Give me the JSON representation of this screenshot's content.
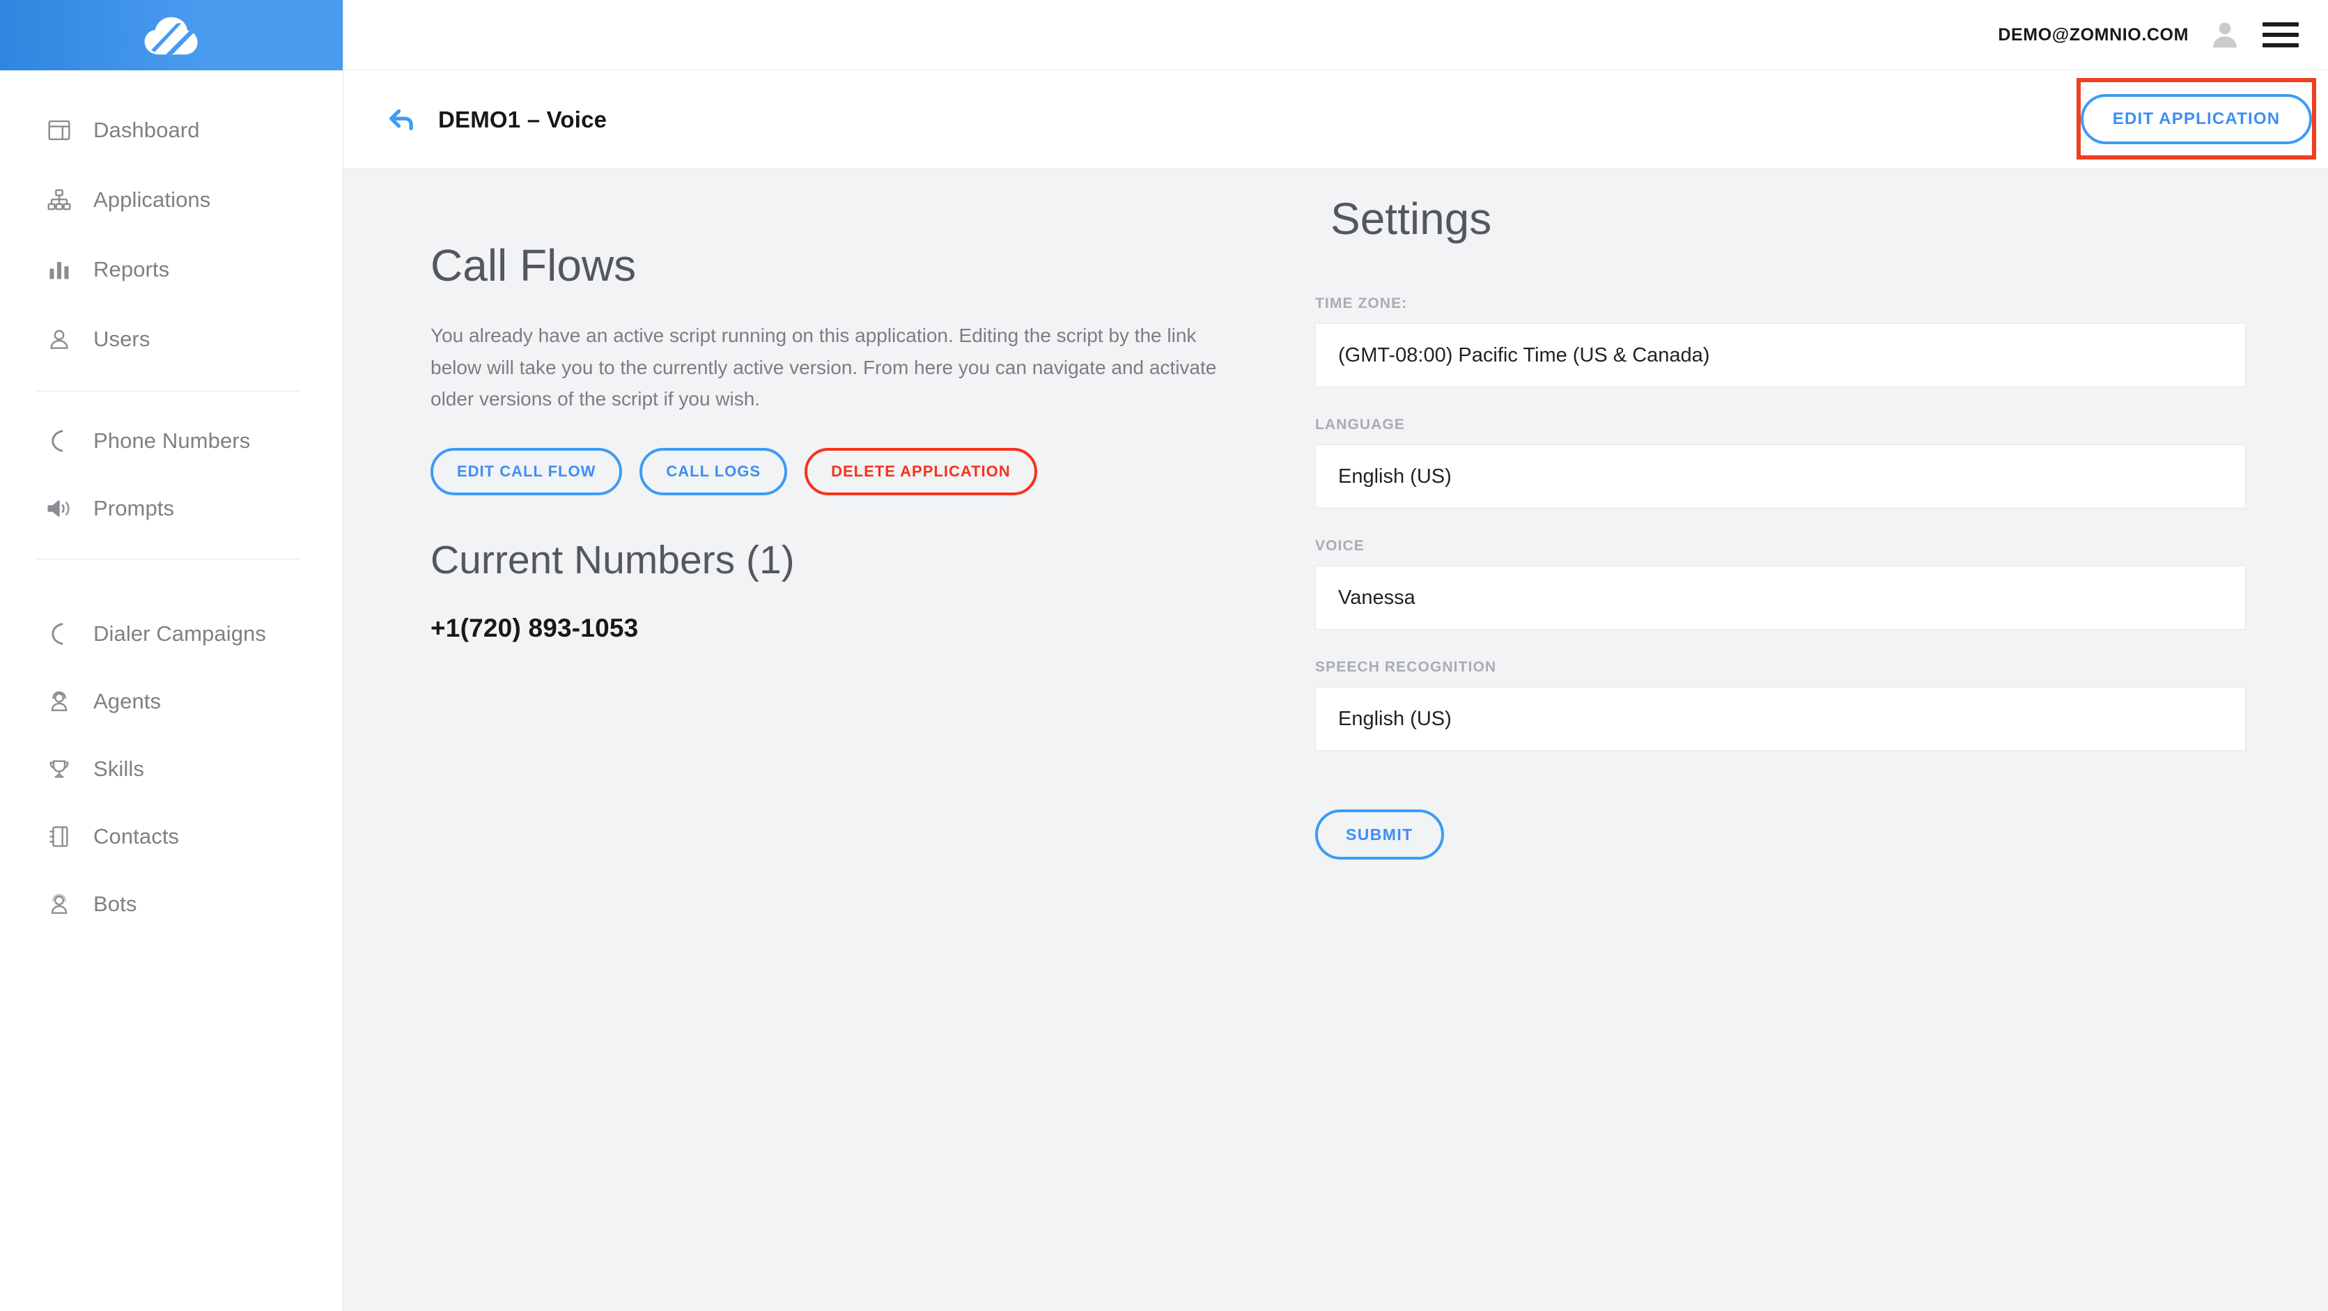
{
  "brand": {
    "logo_icon": "cloud-swoosh-logo",
    "accent_blue": "#3d9bf5",
    "accent_red": "#f5321a",
    "header_band": "#4a9bf0"
  },
  "sidebar": {
    "groups": [
      {
        "items": [
          {
            "label": "Dashboard",
            "icon": "dashboard-icon"
          },
          {
            "label": "Applications",
            "icon": "sitemap-icon"
          },
          {
            "label": "Reports",
            "icon": "bar-chart-icon"
          },
          {
            "label": "Users",
            "icon": "user-icon"
          }
        ]
      },
      {
        "items": [
          {
            "label": "Phone Numbers",
            "icon": "phone-icon"
          },
          {
            "label": "Prompts",
            "icon": "speaker-icon"
          }
        ]
      },
      {
        "items": [
          {
            "label": "Dialer Campaigns",
            "icon": "phone-icon"
          },
          {
            "label": "Agents",
            "icon": "agent-headset-icon"
          },
          {
            "label": "Skills",
            "icon": "trophy-icon"
          },
          {
            "label": "Contacts",
            "icon": "address-book-icon"
          },
          {
            "label": "Bots",
            "icon": "bot-icon"
          }
        ]
      }
    ]
  },
  "topbar": {
    "user_email": "DEMO@ZOMNIO.COM",
    "avatar_icon": "avatar-icon",
    "menu_icon": "hamburger-menu-icon"
  },
  "titlebar": {
    "back_icon": "back-arrow-icon",
    "title": "DEMO1 – Voice",
    "edit_application_label": "EDIT APPLICATION"
  },
  "call_flows": {
    "heading": "Call Flows",
    "description": "You already have an active script running on this application. Editing the script by the link below will take you to the currently active version. From here you can navigate and activate older versions of the script if you wish.",
    "buttons": {
      "edit_call_flow": "EDIT CALL FLOW",
      "call_logs": "CALL LOGS",
      "delete_application": "DELETE APPLICATION"
    }
  },
  "current_numbers": {
    "heading": "Current Numbers (1)",
    "numbers": [
      "+1(720) 893-1053"
    ]
  },
  "settings": {
    "heading": "Settings",
    "fields": [
      {
        "label": "TIME ZONE:",
        "value": "(GMT-08:00) Pacific Time (US & Canada)"
      },
      {
        "label": "LANGUAGE",
        "value": "English (US)"
      },
      {
        "label": "VOICE",
        "value": "Vanessa"
      },
      {
        "label": "SPEECH RECOGNITION",
        "value": "English (US)"
      }
    ],
    "submit_label": "SUBMIT"
  }
}
